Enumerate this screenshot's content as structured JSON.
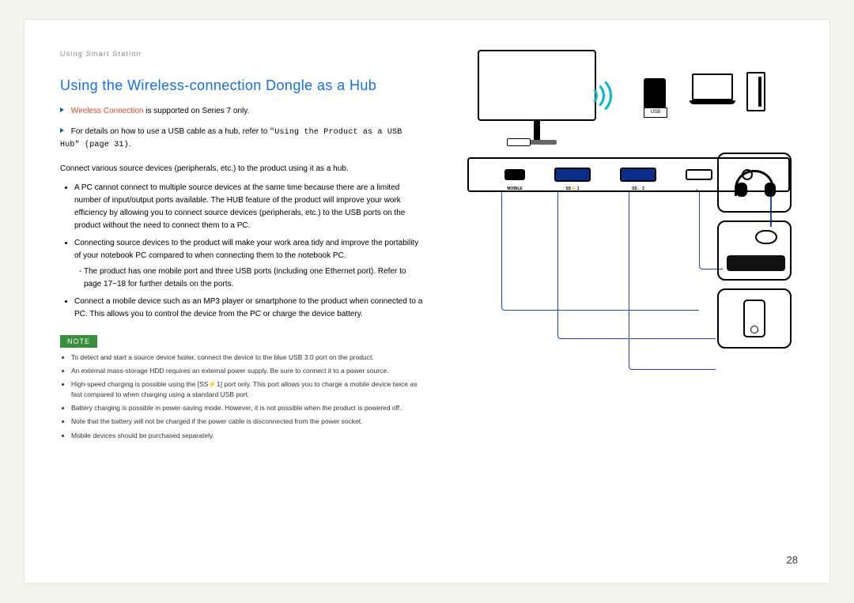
{
  "breadcrumb": "Using Smart Station",
  "title": "Using the Wireless-connection Dongle as a Hub",
  "lead1_red": "Wireless Connection",
  "lead1_rest": " is supported on Series 7 only.",
  "lead2_a": "For details on how to use a USB cable as a hub, refer to ",
  "lead2_mono": "\"Using the Product as a USB Hub\" (page 31)",
  "lead2_b": ".",
  "intro": "Connect various source devices (peripherals, etc.) to the product using it as a hub.",
  "bullets": [
    "A PC cannot connect to multiple source devices at the same time because there are a limited number of input/output ports available. The HUB feature of the product will improve your work efficiency by allowing you to connect source devices (peripherals, etc.) to the USB ports on the product without the need to connect them to a PC.",
    "Connecting source devices to the product will make your work area tidy and improve the portability of your notebook PC compared to when connecting them to the notebook PC.",
    "Connect a mobile device such as an MP3 player or smartphone to the product when connected to a PC. This allows you to control the device from the PC or charge the device battery."
  ],
  "sub_bullet": "The product has one mobile port and three USB ports (including one Ethernet port). Refer to page 17~18 for further details on the ports.",
  "note_label": "NOTE",
  "notes": [
    "To detect and start a source device faster, connect the device to the blue USB 3.0 port on the product.",
    "An external mass-storage HDD requires an external power supply. Be sure to connect it to a power source.",
    "High-speed charging is possible using the [SS⚡1] port only. This port allows you to charge a mobile device twice as fast compared to when charging using a standard USB port.",
    "Battery charging is possible in power-saving mode. However, it is not possible when the product is powered off.",
    "Note that the battery will not be charged if the power cable is disconnected from the power socket.",
    "Mobile devices should be purchased separately."
  ],
  "page_number": "28",
  "hub_ports": {
    "mobile": "MOBILE",
    "p1": "SS⚡ 1",
    "p2": "SS← 2",
    "p3": "•←",
    "audio": "♫"
  }
}
